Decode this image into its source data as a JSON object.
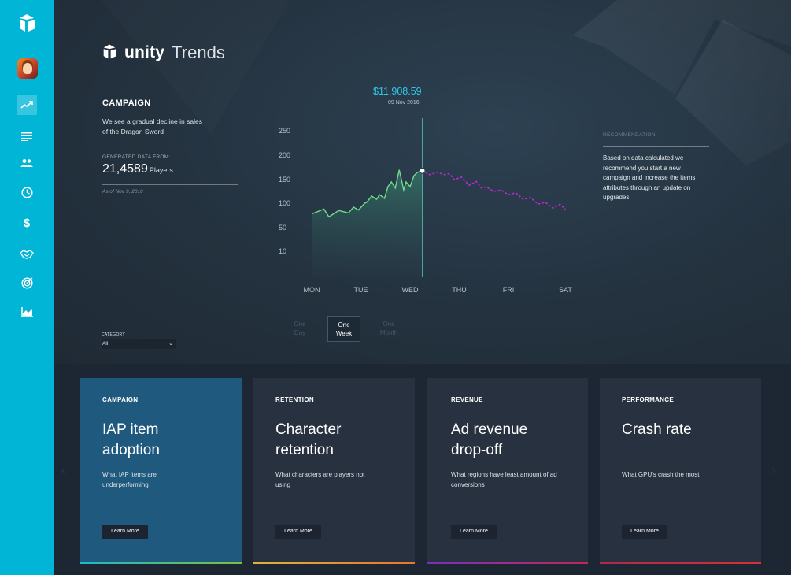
{
  "sidebar": {
    "icons": [
      "unity-logo-icon",
      "avatar",
      "trends-icon",
      "list-icon",
      "people-icon",
      "clock-icon",
      "dollar-icon",
      "handshake-icon",
      "target-icon",
      "area-chart-icon"
    ]
  },
  "header": {
    "logo_word": "unity",
    "logo_sub": "Trends"
  },
  "campaign": {
    "title": "CAMPAIGN",
    "description": "We see a gradual decline in sales of the Dragon Sword",
    "generated_label": "GENERATED DATA FROM:",
    "generated_value": "21,4589",
    "generated_unit": "Players",
    "as_of": "As of Nov 9, 2016"
  },
  "highlight": {
    "value": "$11,908.59",
    "date": "09 Nov 2016"
  },
  "recommendation": {
    "label": "RECOMMENDATION",
    "text": "Based on data calculated we recommend you start a new campaign and increase the items attributes through an update on upgrades."
  },
  "range_selector": {
    "options": [
      {
        "line1": "One",
        "line2": "Day",
        "active": false
      },
      {
        "line1": "One",
        "line2": "Week",
        "active": true
      },
      {
        "line1": "One",
        "line2": "Month",
        "active": false
      }
    ]
  },
  "category": {
    "label": "CATEGORY",
    "value": "All"
  },
  "cards": [
    {
      "label": "CAMPAIGN",
      "title": "IAP item adoption",
      "description": "What IAP items are underperforming",
      "button": "Learn More"
    },
    {
      "label": "RETENTION",
      "title": "Character retention",
      "description": "What characters are players not using",
      "button": "Learn More"
    },
    {
      "label": "REVENUE",
      "title": "Ad revenue drop-off",
      "description": "What regions have least amount of ad conversions",
      "button": "Learn More"
    },
    {
      "label": "PERFORMANCE",
      "title": "Crash rate",
      "description": "What GPU's crash the most",
      "button": "Learn More"
    }
  ],
  "colors": {
    "sidebar": "#00b5d6",
    "accent_cyan": "#2fc9e8",
    "actual_line": "#6fdc8c",
    "forecast_line": "#c026d3",
    "card_active": "#1f5a7e",
    "card_bars": [
      [
        "#1fb8c8",
        "#7bc043"
      ],
      [
        "#e0b33a",
        "#e8742d"
      ],
      [
        "#7b2fbf",
        "#c0285a"
      ],
      [
        "#b02a4a",
        "#d62f3a"
      ]
    ]
  },
  "chart_data": {
    "type": "line",
    "categories": [
      "MON",
      "TUE",
      "WED",
      "THU",
      "FRI",
      "SAT"
    ],
    "yticks": [
      250,
      200,
      150,
      100,
      50,
      10
    ],
    "series": [
      {
        "style": "solid",
        "x": [
          0,
          0.25,
          0.35,
          0.55,
          0.75,
          0.85,
          0.95,
          1.08,
          1.12,
          1.22,
          1.32,
          1.38,
          1.48,
          1.55,
          1.62,
          1.7,
          1.78,
          1.87,
          1.92,
          2.0,
          2.08,
          2.15,
          2.25
        ],
        "values": [
          78,
          88,
          72,
          85,
          80,
          92,
          86,
          100,
          102,
          115,
          108,
          118,
          110,
          135,
          145,
          132,
          170,
          128,
          145,
          135,
          158,
          165,
          168
        ]
      },
      {
        "style": "dotted",
        "x": [
          2.25,
          2.4,
          2.55,
          2.7,
          2.8,
          2.9,
          3.05,
          3.2,
          3.35,
          3.45,
          3.55,
          3.7,
          3.85,
          4.0,
          4.15,
          4.3,
          4.45,
          4.6,
          4.75,
          4.9,
          5.05,
          5.15
        ],
        "values": [
          168,
          160,
          165,
          160,
          162,
          150,
          155,
          138,
          146,
          132,
          135,
          125,
          128,
          118,
          122,
          108,
          112,
          98,
          102,
          90,
          98,
          88
        ]
      }
    ],
    "highlight_x": 2.25,
    "highlight_value": "$11,908.59",
    "highlight_date": "09 Nov 2016"
  }
}
